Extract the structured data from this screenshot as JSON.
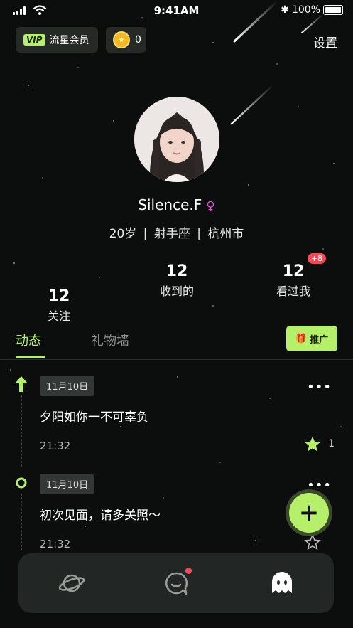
{
  "status_bar": {
    "time": "9:41AM",
    "battery": "100%"
  },
  "header": {
    "vip_tag": "VIP",
    "vip_label": "流星会员",
    "coin_count": "0",
    "settings_label": "设置"
  },
  "profile": {
    "name": "Silence.F",
    "gender_symbol": "♀",
    "age": "20岁",
    "zodiac": "射手座",
    "city": "杭州市",
    "separator": "|"
  },
  "stats": [
    {
      "value": "12",
      "label": "关注"
    },
    {
      "value": "12",
      "label": "收到的"
    },
    {
      "value": "12",
      "label": "看过我",
      "badge": "+8"
    }
  ],
  "tabs": [
    {
      "label": "动态",
      "active": true
    },
    {
      "label": "礼物墙",
      "active": false
    }
  ],
  "promote_label": "推广",
  "posts": [
    {
      "date": "11月10日",
      "text": "夕阳如你一不可辜负",
      "time": "21:32",
      "star_count": "1",
      "starred": true,
      "timeline_icon": "arrow-up-icon"
    },
    {
      "date": "11月10日",
      "text": "初次见面，请多关照～",
      "time": "21:32",
      "star_count": "",
      "starred": false,
      "timeline_icon": "ring-icon"
    }
  ],
  "more_label": "•••",
  "fab_label": "+",
  "nav_icons": [
    "planet-icon",
    "chat-icon",
    "ghost-icon"
  ],
  "colors": {
    "accent": "#b6f06a",
    "background": "#0b0e0c",
    "badge": "#ef4b58",
    "gender": "#e04fd3"
  }
}
